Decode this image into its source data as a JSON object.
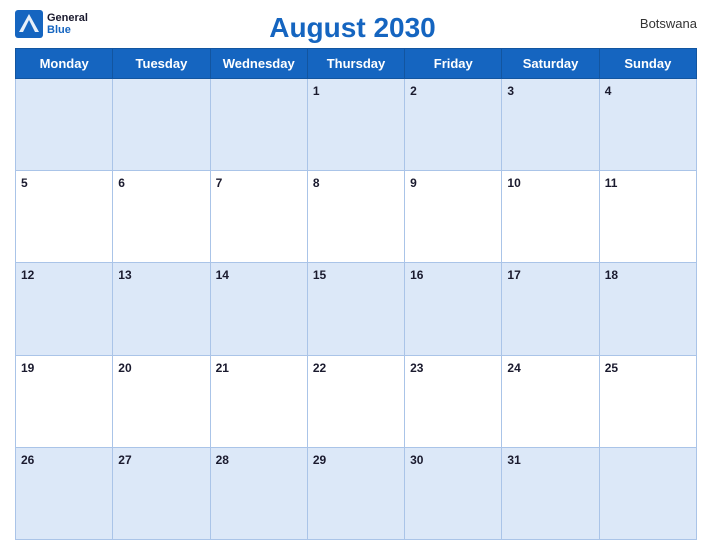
{
  "header": {
    "title": "August 2030",
    "country": "Botswana",
    "logo_general": "General",
    "logo_blue": "Blue"
  },
  "weekdays": [
    "Monday",
    "Tuesday",
    "Wednesday",
    "Thursday",
    "Friday",
    "Saturday",
    "Sunday"
  ],
  "weeks": [
    [
      {
        "day": "",
        "empty": true
      },
      {
        "day": "",
        "empty": true
      },
      {
        "day": "",
        "empty": true
      },
      {
        "day": "1",
        "empty": false
      },
      {
        "day": "2",
        "empty": false
      },
      {
        "day": "3",
        "empty": false
      },
      {
        "day": "4",
        "empty": false
      }
    ],
    [
      {
        "day": "5",
        "empty": false
      },
      {
        "day": "6",
        "empty": false
      },
      {
        "day": "7",
        "empty": false
      },
      {
        "day": "8",
        "empty": false
      },
      {
        "day": "9",
        "empty": false
      },
      {
        "day": "10",
        "empty": false
      },
      {
        "day": "11",
        "empty": false
      }
    ],
    [
      {
        "day": "12",
        "empty": false
      },
      {
        "day": "13",
        "empty": false
      },
      {
        "day": "14",
        "empty": false
      },
      {
        "day": "15",
        "empty": false
      },
      {
        "day": "16",
        "empty": false
      },
      {
        "day": "17",
        "empty": false
      },
      {
        "day": "18",
        "empty": false
      }
    ],
    [
      {
        "day": "19",
        "empty": false
      },
      {
        "day": "20",
        "empty": false
      },
      {
        "day": "21",
        "empty": false
      },
      {
        "day": "22",
        "empty": false
      },
      {
        "day": "23",
        "empty": false
      },
      {
        "day": "24",
        "empty": false
      },
      {
        "day": "25",
        "empty": false
      }
    ],
    [
      {
        "day": "26",
        "empty": false
      },
      {
        "day": "27",
        "empty": false
      },
      {
        "day": "28",
        "empty": false
      },
      {
        "day": "29",
        "empty": false
      },
      {
        "day": "30",
        "empty": false
      },
      {
        "day": "31",
        "empty": false
      },
      {
        "day": "",
        "empty": true
      }
    ]
  ]
}
